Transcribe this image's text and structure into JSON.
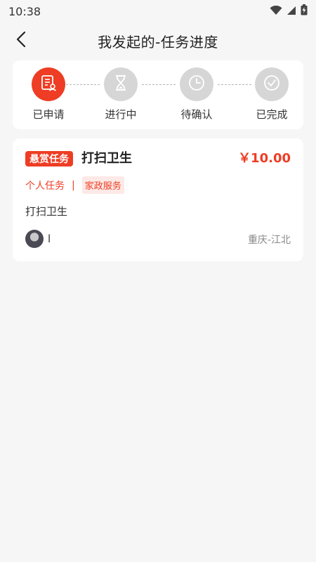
{
  "status_bar": {
    "time": "10:38",
    "icons": [
      "wifi-icon",
      "signal-icon",
      "battery-icon"
    ]
  },
  "header": {
    "title": "我发起的-任务进度",
    "back_icon": "chevron-left-icon"
  },
  "progress": {
    "steps": [
      {
        "label": "已申请",
        "icon": "application-form-icon",
        "active": true
      },
      {
        "label": "进行中",
        "icon": "hourglass-icon",
        "active": false
      },
      {
        "label": "待确认",
        "icon": "clock-icon",
        "active": false
      },
      {
        "label": "已完成",
        "icon": "check-circle-icon",
        "active": false
      }
    ],
    "active_color": "#ee3d24",
    "inactive_color": "#d6d6d6"
  },
  "task": {
    "badge": "悬赏任务",
    "title": "打扫卫生",
    "price": "￥10.00",
    "type": "个人任务",
    "separator": "|",
    "category": "家政服务",
    "description": "打扫卫生",
    "user_name": "l",
    "location": "重庆-江北"
  },
  "colors": {
    "accent": "#ee3d24",
    "background": "#f6f6f6",
    "card": "#ffffff"
  }
}
